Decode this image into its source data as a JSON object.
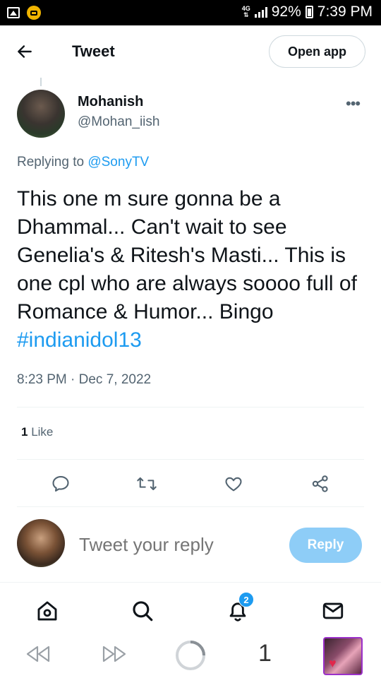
{
  "status_bar": {
    "network": "4G",
    "battery": "92%",
    "time": "7:39 PM",
    "icons": [
      "gallery-icon",
      "coin-icon",
      "signal-icon",
      "battery-icon"
    ]
  },
  "header": {
    "back_icon": "arrow-left-icon",
    "title": "Tweet",
    "open_app_label": "Open app"
  },
  "tweet": {
    "author_name": "Mohanish",
    "author_handle": "@Mohan_iish",
    "more_icon": "more-horizontal-icon",
    "replying_prefix": "Replying to",
    "replying_to": "@SonyTV",
    "text": "This one m sure gonna be a Dhammal... Can't wait to see Genelia's & Ritesh's Masti... This is one cpl who are always soooo full of Romance &  Humor... Bingo",
    "hashtag": "#indianidol13",
    "timestamp": "8:23 PM · Dec 7, 2022",
    "like_count": "1",
    "like_label": "Like"
  },
  "actions": [
    "reply-icon",
    "retweet-icon",
    "like-icon",
    "share-icon"
  ],
  "composer": {
    "placeholder": "Tweet your reply",
    "reply_label": "Reply"
  },
  "tab_bar": {
    "items": [
      "home-icon",
      "search-icon",
      "notifications-icon",
      "messages-icon"
    ],
    "notification_badge": "2"
  },
  "browser_bar": {
    "tab_count": "1"
  },
  "colors": {
    "accent": "#1d9bf0",
    "reply_button": "#8ecdf7",
    "secondary_text": "#536471",
    "primary_text": "#0f1419"
  }
}
